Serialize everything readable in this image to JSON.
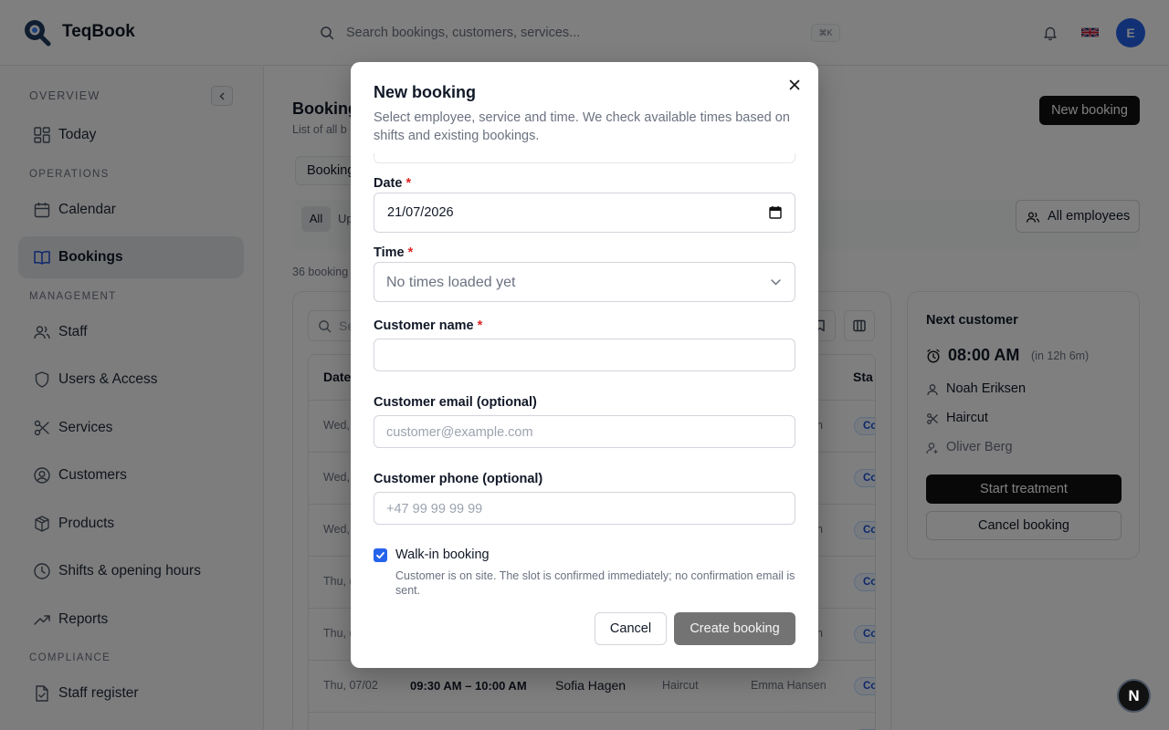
{
  "app": {
    "name": "TeqBook"
  },
  "header": {
    "search_placeholder": "Search bookings, customers, services...",
    "shortcut": "⌘K",
    "avatar_initial": "E"
  },
  "sidebar": {
    "sections": {
      "overview": "OVERVIEW",
      "operations": "OPERATIONS",
      "management": "MANAGEMENT",
      "compliance": "COMPLIANCE"
    },
    "items": [
      {
        "label": "Today",
        "icon": "dashboard-icon"
      },
      {
        "label": "Calendar",
        "icon": "calendar-icon"
      },
      {
        "label": "Bookings",
        "icon": "book-icon",
        "active": true
      },
      {
        "label": "Staff",
        "icon": "users-icon"
      },
      {
        "label": "Users & Access",
        "icon": "shield-icon"
      },
      {
        "label": "Services",
        "icon": "scissors-icon"
      },
      {
        "label": "Customers",
        "icon": "user-circle-icon"
      },
      {
        "label": "Products",
        "icon": "package-icon"
      },
      {
        "label": "Shifts & opening hours",
        "icon": "clock-icon"
      },
      {
        "label": "Reports",
        "icon": "trending-up-icon"
      },
      {
        "label": "Staff register",
        "icon": "file-check-icon"
      }
    ]
  },
  "main": {
    "title": "Booking",
    "subtitle": "List of all b",
    "new_booking_label": "New booking",
    "tab_label": "Booking",
    "filters": {
      "all": "All",
      "upcoming": "Up"
    },
    "all_employees_label": "All employees",
    "count_text": "36 booking",
    "table": {
      "search_placeholder": "Se",
      "headers": {
        "date": "Date",
        "status": "Sta"
      },
      "rows": [
        {
          "date": "Wed,",
          "time": "",
          "customer": "",
          "service": "",
          "employee": "n",
          "status": "Co"
        },
        {
          "date": "Wed,",
          "time": "",
          "customer": "",
          "service": "",
          "employee": "",
          "status": "Co"
        },
        {
          "date": "Wed,",
          "time": "",
          "customer": "",
          "service": "",
          "employee": "n",
          "status": "Co"
        },
        {
          "date": "Thu, (",
          "time": "",
          "customer": "",
          "service": "",
          "employee": "",
          "status": "Co"
        },
        {
          "date": "Thu, (",
          "time": "",
          "customer": "",
          "service": "",
          "employee": "n",
          "status": "Co"
        },
        {
          "date": "Thu, 07/02",
          "time": "09:30 AM – 10:00 AM",
          "customer": "Sofia Hagen",
          "service": "Haircut",
          "employee": "Emma Hansen",
          "status": "Co"
        }
      ]
    },
    "next_customer": {
      "title": "Next customer",
      "time": "08:00 AM",
      "in_text": "(in 12h 6m)",
      "customer": "Noah Eriksen",
      "service": "Haircut",
      "employee": "Oliver Berg",
      "start_label": "Start treatment",
      "cancel_label": "Cancel booking"
    }
  },
  "modal": {
    "title": "New booking",
    "description": "Select employee, service and time. We check available times based on shifts and existing bookings.",
    "date_label": "Date",
    "date_value": "21/07/2026",
    "time_label": "Time",
    "time_placeholder": "No times loaded yet",
    "name_label": "Customer name",
    "name_value": "",
    "email_label": "Customer email (optional)",
    "email_placeholder": "customer@example.com",
    "phone_label": "Customer phone (optional)",
    "phone_placeholder": "+47 99 99 99 99",
    "required_mark": "*",
    "walkin_label": "Walk-in booking",
    "walkin_checked": true,
    "walkin_help": "Customer is on site. The slot is confirmed immediately; no confirmation email is sent.",
    "cancel_label": "Cancel",
    "create_label": "Create booking"
  },
  "dev_badge": "N",
  "colors": {
    "accent": "#2563eb",
    "primary_button": "#111111",
    "required": "#dc2626"
  }
}
